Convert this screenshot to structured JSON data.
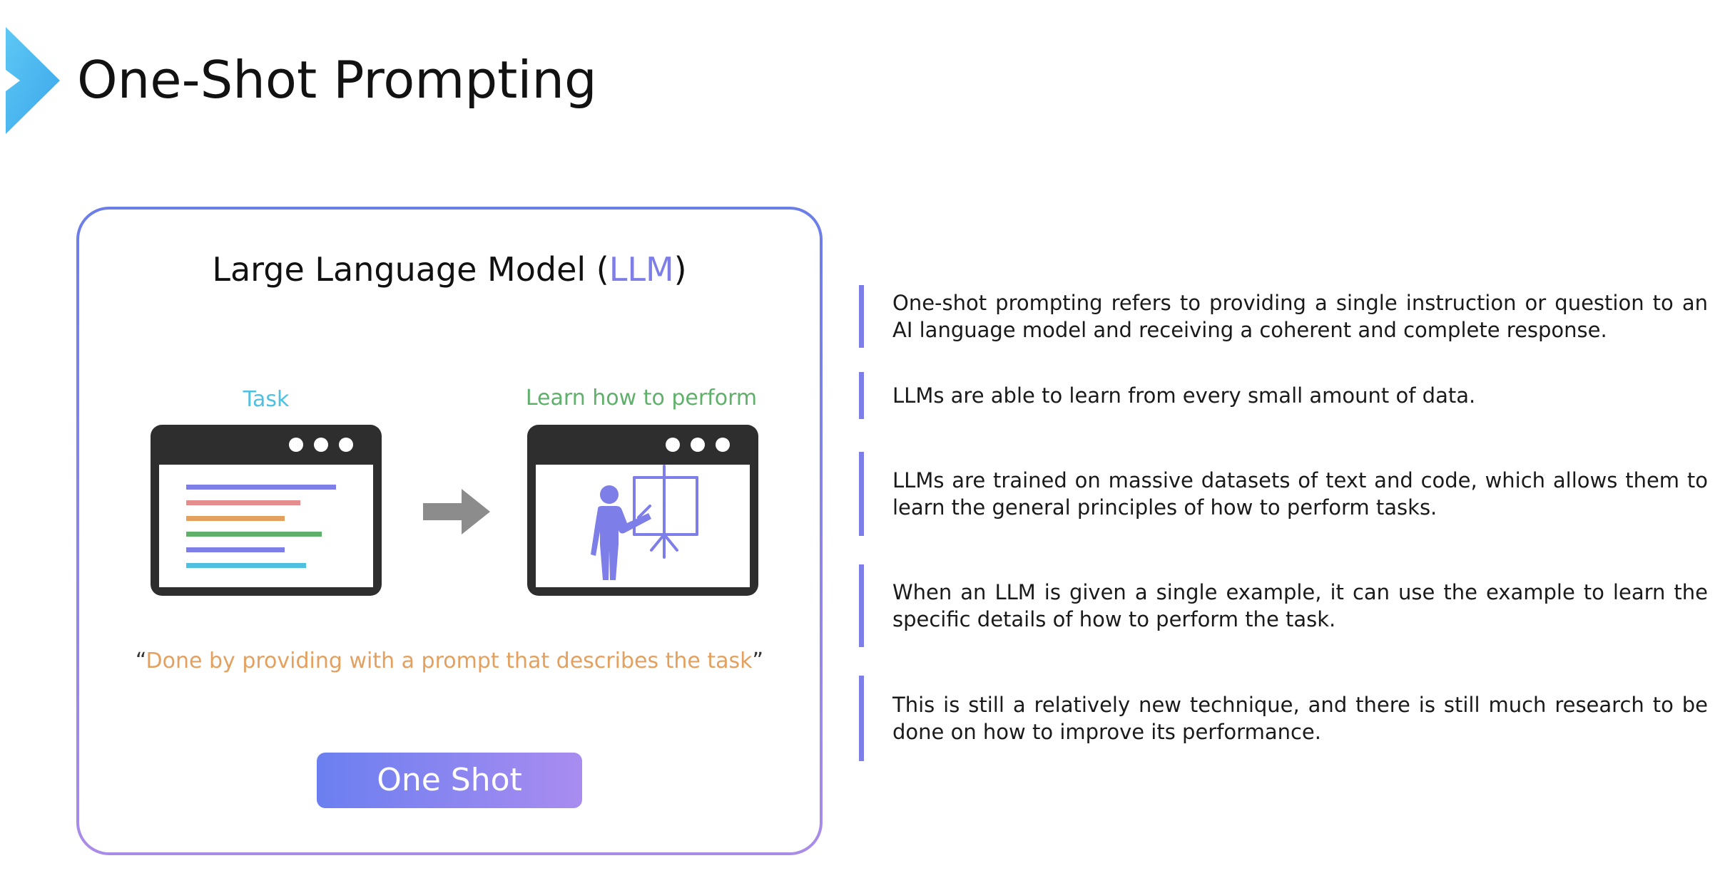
{
  "slide": {
    "title": "One-Shot Prompting"
  },
  "colors": {
    "accent": "#7e7ee8",
    "chevron": "#4fb8ef",
    "task": "#4fc0e0",
    "learn": "#5fb06a",
    "caption": "#e3a05f",
    "button_start": "#6b7ff0",
    "button_end": "#a98cf0"
  },
  "card": {
    "title_prefix": "Large Language Model (",
    "title_abbr": "LLM",
    "title_suffix": ")",
    "task_label": "Task",
    "learn_label": "Learn how to perform",
    "caption_open": "“",
    "caption": "Done by providing with a prompt that describes the task",
    "caption_close": "”",
    "button_label": "One Shot",
    "icons": [
      "text-window-icon",
      "arrow-right-icon",
      "presentation-window-icon"
    ]
  },
  "points": [
    {
      "text": "One-shot prompting refers to providing a single instruction or question to an AI language model and receiving a coherent and complete response."
    },
    {
      "text": "LLMs are able to learn from every small amount of data."
    },
    {
      "text": "LLMs are trained on massive datasets of text and code, which allows them to learn the general principles of how to perform tasks."
    },
    {
      "text": "When an LLM is given a single example, it can use the example to learn the specific details of how to perform the task."
    },
    {
      "text": "This is still a relatively new technique, and there is still much research to be done on how to improve its performance."
    }
  ]
}
